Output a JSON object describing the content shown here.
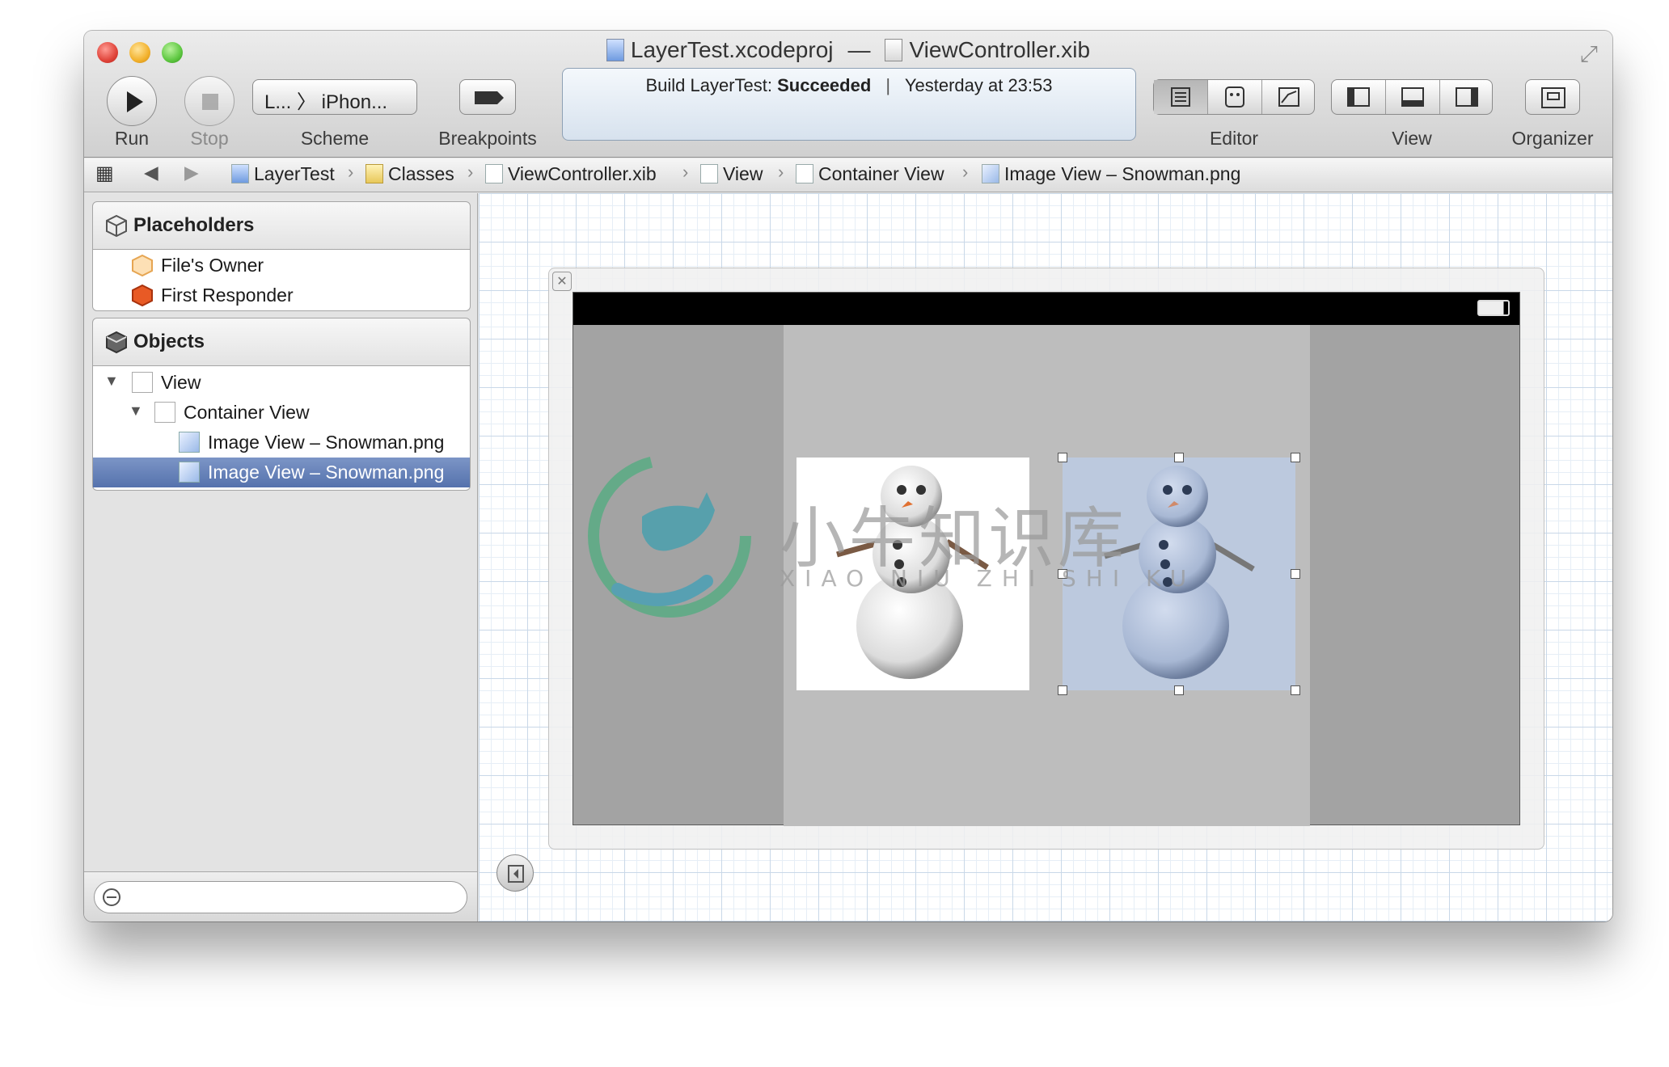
{
  "window": {
    "title_left": "LayerTest.xcodeproj",
    "title_sep": "—",
    "title_right": "ViewController.xib"
  },
  "toolbar": {
    "run_label": "Run",
    "stop_label": "Stop",
    "scheme_value": "L... 〉 iPhon...",
    "scheme_label": "Scheme",
    "breakpoints_label": "Breakpoints",
    "editor_label": "Editor",
    "view_label": "View",
    "organizer_label": "Organizer"
  },
  "activity": {
    "prefix": "Build LayerTest: ",
    "status": "Succeeded",
    "divider": "|",
    "time": "Yesterday at 23:53"
  },
  "jumpbar": {
    "items": [
      "LayerTest",
      "Classes",
      "ViewController.xib",
      "View",
      "Container View",
      "Image View – Snowman.png"
    ]
  },
  "sidebar": {
    "placeholders_title": "Placeholders",
    "placeholders": [
      "File's Owner",
      "First Responder"
    ],
    "objects_title": "Objects",
    "objects": [
      "View",
      "Container View",
      "Image View – Snowman.png",
      "Image View – Snowman.png"
    ]
  },
  "watermark": {
    "title": "小牛知识库",
    "subtitle": "XIAO NIU ZHI SHI KU"
  },
  "colors": {
    "selection": "#5b78b3",
    "canvas_grid": "#c9d8e8",
    "selected_image_bg": "#bcc9de"
  }
}
